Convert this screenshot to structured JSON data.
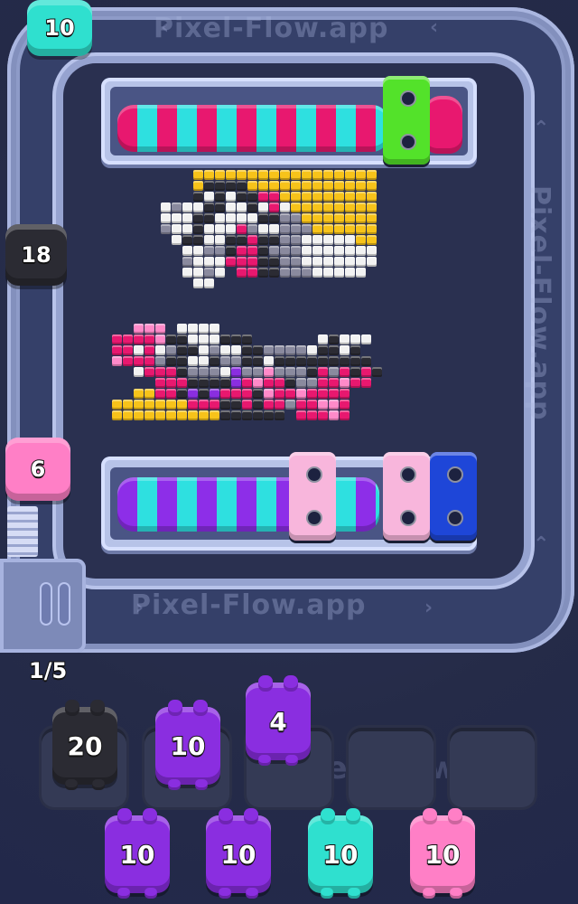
{
  "watermark": "Pixel-Flow.app",
  "counter": "1/5",
  "track_creatures": [
    {
      "name": "cyan",
      "value": "10",
      "color": "#2fe0cf"
    },
    {
      "name": "black",
      "value": "18",
      "color": "#2b2b33"
    },
    {
      "name": "pink",
      "value": "6",
      "color": "#ff7fc6"
    }
  ],
  "slot_creatures": [
    {
      "name": "black",
      "value": "20",
      "color": "#2b2b33"
    },
    {
      "name": "purple",
      "value": "10",
      "color": "#8a2ee0"
    },
    {
      "name": "purple",
      "value": "4",
      "color": "#8a2ee0"
    }
  ],
  "queue_creatures": [
    {
      "name": "purple",
      "value": "10",
      "color": "#8a2ee0"
    },
    {
      "name": "purple",
      "value": "10",
      "color": "#8a2ee0"
    },
    {
      "name": "cyan",
      "value": "10",
      "color": "#2fe0cf"
    },
    {
      "name": "pink",
      "value": "10",
      "color": "#ff7fc6"
    }
  ],
  "colors": {
    "magenta": "#e8186f",
    "cyan": "#2fe0cf",
    "yellow": "#f7c31a",
    "white": "#f2f2f2",
    "black": "#2b2b33",
    "gray": "#8a8a9e",
    "purple": "#8a2ee0",
    "pink": "#ff8ac9",
    "green": "#53e22a",
    "blue": "#1e46d8",
    "light_pink": "#f8b6dc"
  }
}
